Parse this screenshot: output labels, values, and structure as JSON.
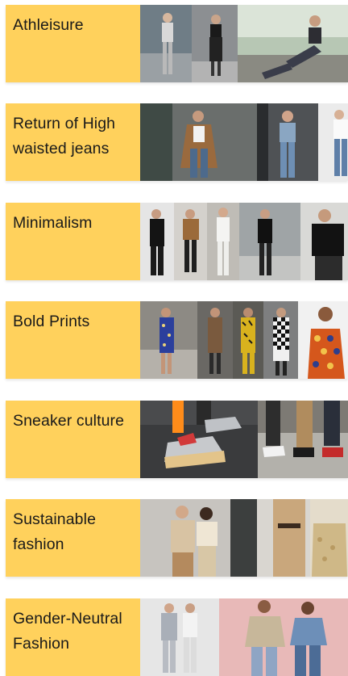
{
  "trends": [
    {
      "label": "Athleisure"
    },
    {
      "label": "Return of High waisted jeans"
    },
    {
      "label": "Minimalism"
    },
    {
      "label": "Bold Prints"
    },
    {
      "label": "Sneaker culture"
    },
    {
      "label": "Sustainable fashion"
    },
    {
      "label": "Gender-Neutral Fashion"
    }
  ],
  "colors": {
    "label_background": "#ffd15c",
    "label_text": "#1a1a1a"
  }
}
